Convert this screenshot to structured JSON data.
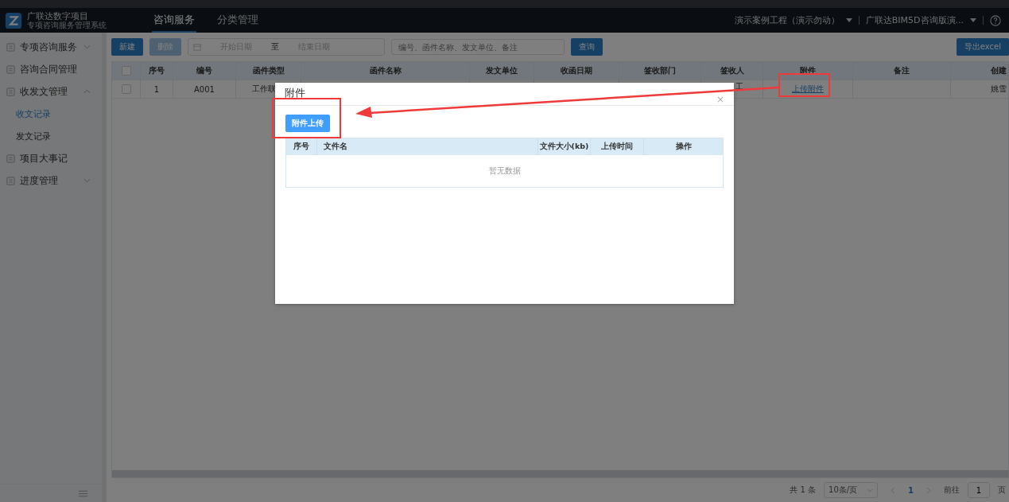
{
  "header": {
    "app_title": "广联达数字项目",
    "app_subtitle": "专项咨询服务管理系统",
    "tabs": [
      {
        "label": "咨询服务",
        "selected": true
      },
      {
        "label": "分类管理",
        "selected": false
      }
    ],
    "project": "演示案例工程（演示勿动）",
    "product": "广联达BIM5D咨询版演..."
  },
  "sidebar": {
    "items": [
      {
        "label": "专项咨询服务",
        "kind": "group",
        "expanded": false
      },
      {
        "label": "咨询合同管理",
        "kind": "link"
      },
      {
        "label": "收发文管理",
        "kind": "group",
        "expanded": true,
        "children": [
          {
            "label": "收文记录",
            "selected": true
          },
          {
            "label": "发文记录",
            "selected": false
          }
        ]
      },
      {
        "label": "项目大事记",
        "kind": "link"
      },
      {
        "label": "进度管理",
        "kind": "group",
        "expanded": false
      }
    ]
  },
  "toolbar": {
    "buttons": [
      {
        "label": "新建",
        "disabled": false
      },
      {
        "label": "删除",
        "disabled": true
      }
    ],
    "start_placeholder": "开始日期",
    "range_separator": "至",
    "end_placeholder": "结束日期",
    "search_placeholder": "编号、函件名称、发文单位、备注",
    "query": "查询",
    "export": "导出excel"
  },
  "table": {
    "select_all_checked": false,
    "columns": [
      "序号",
      "编号",
      "函件类型",
      "函件名称",
      "发文单位",
      "收函日期",
      "签收部门",
      "签收人",
      "附件",
      "备注",
      "创建"
    ],
    "rows": [
      {
        "checked": false,
        "cells": {
          "序号": "1",
          "编号": "A001",
          "函件类型": "工作联",
          "签收人": "工",
          "附件": "上传附件",
          "创建": "姚雪"
        }
      }
    ]
  },
  "pagination": {
    "total": "共 1 条",
    "page_size": "10条/页",
    "current": "1",
    "goto_label": "前往",
    "goto_value": "1",
    "page_unit": "页"
  },
  "dialog": {
    "title": "附件",
    "close": "×",
    "upload": "附件上传",
    "columns": [
      "序号",
      "文件名",
      "文件大小(kb)",
      "上传时间",
      "操作"
    ],
    "empty": "暂无数据"
  }
}
